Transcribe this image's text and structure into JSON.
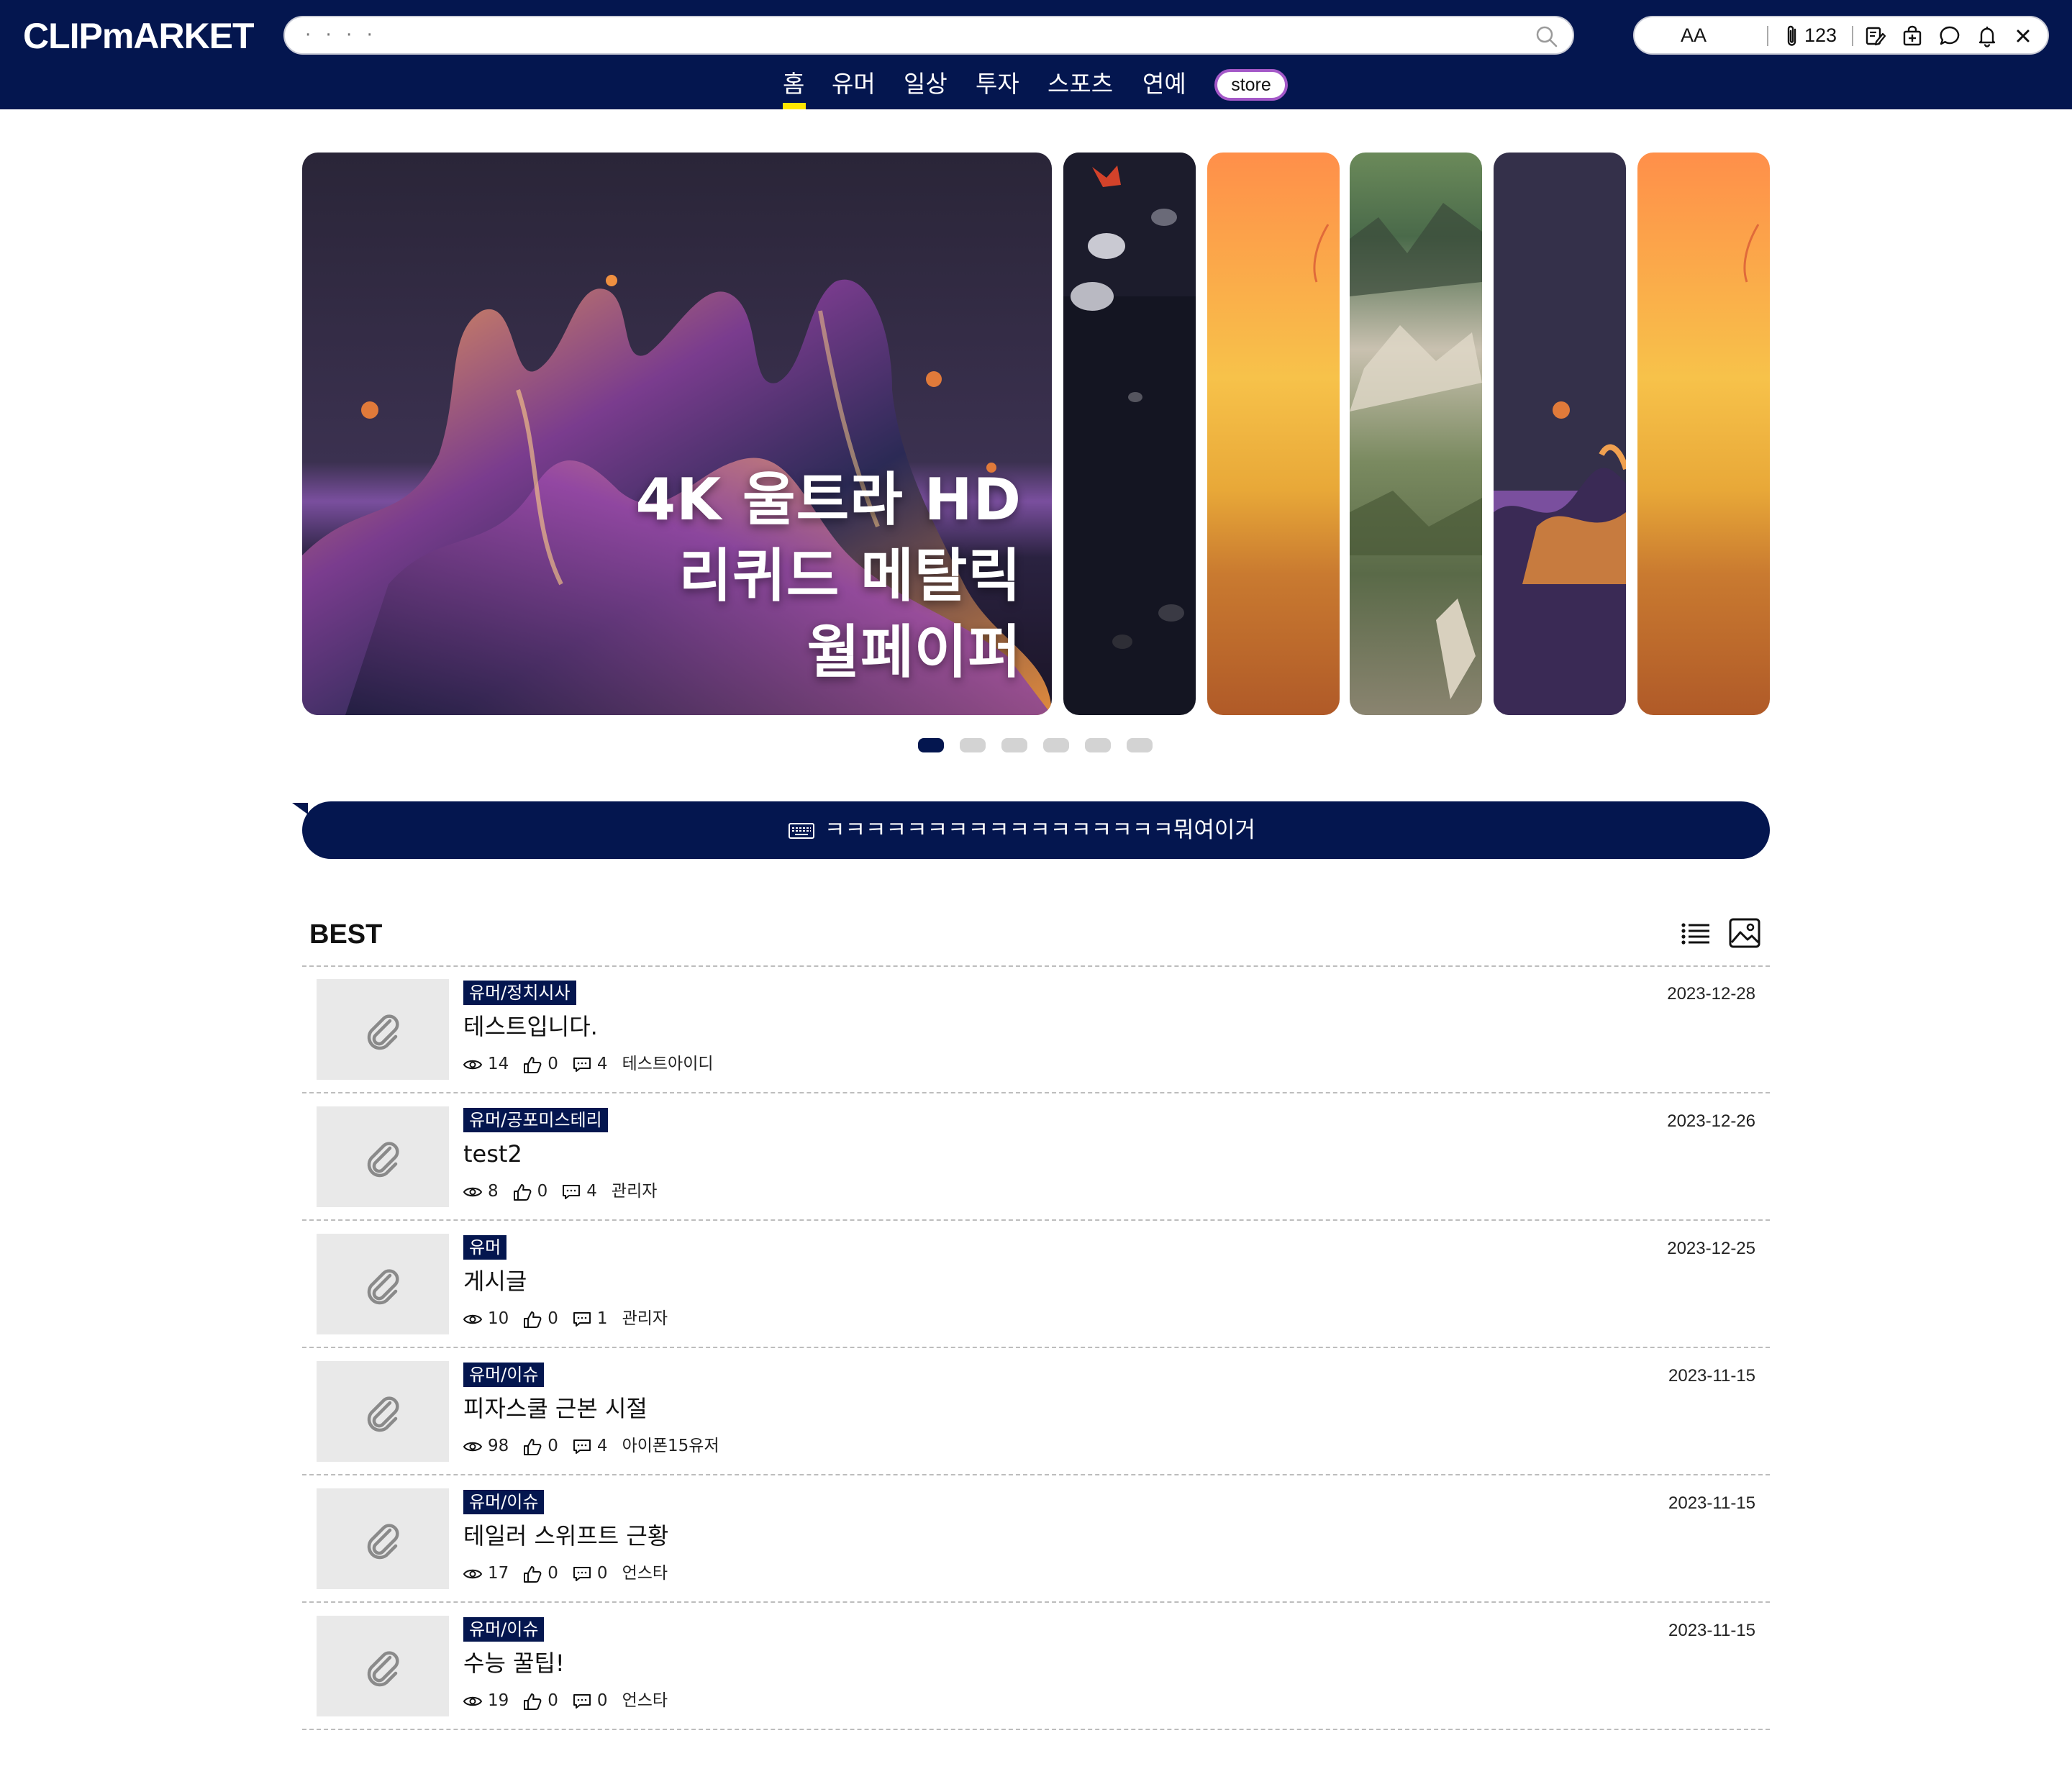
{
  "header": {
    "logo": "CLIPmARKET",
    "search_placeholder": "· · · ·",
    "font_toggle": "AA",
    "attachment_count": "123",
    "nav": [
      "홈",
      "유머",
      "일상",
      "투자",
      "스포츠",
      "연예"
    ],
    "store_label": "store",
    "active_nav": "홈"
  },
  "carousel": {
    "title_lines": [
      "4K 울트라 HD",
      "리퀴드 메탈릭",
      "월페이퍼"
    ],
    "slide_count": 6,
    "active_index": 0
  },
  "notice": {
    "text": "ㅋㅋㅋㅋㅋㅋㅋㅋㅋㅋㅋㅋㅋㅋㅋㅋㅋ뭐여이거"
  },
  "best": {
    "title": "BEST",
    "posts": [
      {
        "category": "유머/정치시사",
        "title": "테스트입니다.",
        "views": "14",
        "likes": "0",
        "comments": "4",
        "author": "테스트아이디",
        "date": "2023-12-28"
      },
      {
        "category": "유머/공포미스테리",
        "title": "test2",
        "views": "8",
        "likes": "0",
        "comments": "4",
        "author": "관리자",
        "date": "2023-12-26"
      },
      {
        "category": "유머",
        "title": "게시글",
        "views": "10",
        "likes": "0",
        "comments": "1",
        "author": "관리자",
        "date": "2023-12-25"
      },
      {
        "category": "유머/이슈",
        "title": "피자스쿨 근본 시절",
        "views": "98",
        "likes": "0",
        "comments": "4",
        "author": "아이폰15유저",
        "date": "2023-11-15"
      },
      {
        "category": "유머/이슈",
        "title": "테일러 스위프트 근황",
        "views": "17",
        "likes": "0",
        "comments": "0",
        "author": "언스타",
        "date": "2023-11-15"
      },
      {
        "category": "유머/이슈",
        "title": "수능 꿀팁!",
        "views": "19",
        "likes": "0",
        "comments": "0",
        "author": "언스타",
        "date": "2023-11-15"
      }
    ]
  },
  "colors": {
    "brand_navy": "#04164f",
    "nav_active_underline": "#ffe600",
    "store_border": "#a458c8",
    "thumb_bg": "#e9e9e9"
  }
}
